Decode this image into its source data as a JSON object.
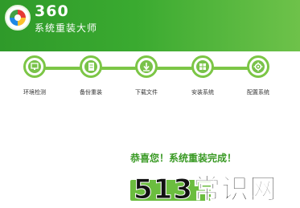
{
  "app": {
    "brand": "360",
    "subtitle": "系统重装大师"
  },
  "steps": [
    {
      "label": "环境检测",
      "icon": "monitor-icon"
    },
    {
      "label": "备份重装",
      "icon": "document-icon"
    },
    {
      "label": "下载文件",
      "icon": "download-icon"
    },
    {
      "label": "安装系统",
      "icon": "windows-icon"
    },
    {
      "label": "配置系统",
      "icon": "gear-icon"
    }
  ],
  "status": {
    "message": "恭喜您！系统重装完成！"
  },
  "watermark": {
    "text": "513常识网"
  },
  "colors": {
    "header": "#3aaa30",
    "accent": "#7cc646",
    "success_text": "#3a9a25"
  }
}
